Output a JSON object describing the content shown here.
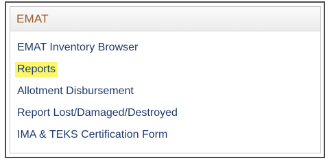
{
  "colors": {
    "header_text": "#9a5a2e",
    "link_text": "#1f3a6d",
    "highlight": "#fbf76a"
  },
  "panel": {
    "title": "EMAT",
    "items": [
      {
        "label": "EMAT Inventory Browser",
        "highlighted": false
      },
      {
        "label": "Reports",
        "highlighted": true
      },
      {
        "label": "Allotment Disbursement",
        "highlighted": false
      },
      {
        "label": "Report Lost/Damaged/Destroyed",
        "highlighted": false
      },
      {
        "label": "IMA & TEKS Certification Form",
        "highlighted": false
      }
    ]
  }
}
